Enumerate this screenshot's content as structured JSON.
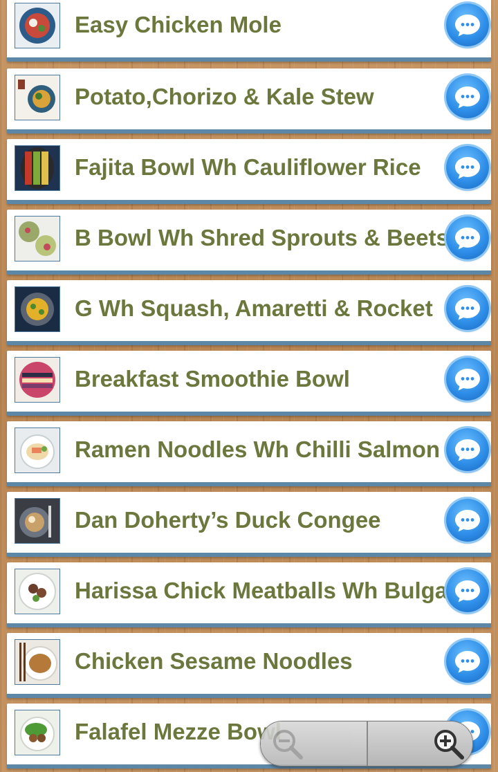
{
  "recipes": [
    {
      "title": "Easy Chicken Mole",
      "thumb": "bowl-food-thumbnail"
    },
    {
      "title": "Potato,Chorizo & Kale Stew",
      "thumb": "stew-thumbnail"
    },
    {
      "title": "Fajita Bowl Wh Cauliflower Rice",
      "thumb": "fajita-bowl-thumbnail"
    },
    {
      "title": "B Bowl Wh Shred Sprouts & Beets",
      "thumb": "sprouts-bowl-thumbnail"
    },
    {
      "title": "G Wh Squash, Amaretti & Rocket",
      "thumb": "squash-thumbnail"
    },
    {
      "title": "Breakfast Smoothie Bowl",
      "thumb": "smoothie-bowl-thumbnail"
    },
    {
      "title": "Ramen Noodles Wh Chilli Salmon",
      "thumb": "ramen-thumbnail"
    },
    {
      "title": "Dan Doherty’s Duck Congee",
      "thumb": "congee-thumbnail"
    },
    {
      "title": "Harissa Chick Meatballs Wh Bulgar",
      "thumb": "meatballs-thumbnail"
    },
    {
      "title": "Chicken Sesame Noodles",
      "thumb": "noodles-thumbnail"
    },
    {
      "title": "Falafel Mezze Bowl",
      "thumb": "falafel-thumbnail"
    }
  ],
  "icons": {
    "row_action": "chat-bubble-icon",
    "zoom_out": "zoom-out-icon",
    "zoom_in": "zoom-in-icon"
  },
  "colors": {
    "title_text": "#6b773c",
    "row_border": "#5c87a6",
    "chat_button": "#2f8fe8"
  }
}
